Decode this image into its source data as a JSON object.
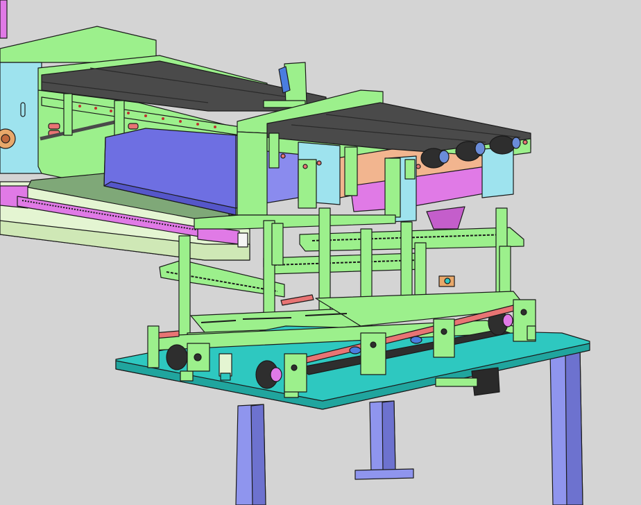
{
  "scene": {
    "kind": "cad-3d-model-render",
    "background": "#d4d4d4",
    "colors": {
      "frame_green": "#9cf08c",
      "frame_green_dark": "#5fb558",
      "edge": "#1a1a1a",
      "belt": "#4a4a4a",
      "roller": "#2e2e2e",
      "cyan_panel": "#9ee3ee",
      "blue_bin": "#6e6fe2",
      "magenta": "#e07ae6",
      "peach": "#f2b58f",
      "teal_base": "#2ec8c0",
      "leg_blue": "#8f95ee",
      "rod_red": "#e87474",
      "light_bed": "#e4f5d2",
      "motor": "#2a2a2a",
      "accent_orange": "#e8a86a"
    },
    "components": [
      {
        "name": "upper-conveyor",
        "icon": "belt-conveyor"
      },
      {
        "name": "lower-conveyor",
        "icon": "belt-conveyor"
      },
      {
        "name": "blue-hopper",
        "icon": "bin"
      },
      {
        "name": "magenta-chute",
        "icon": "chute"
      },
      {
        "name": "linear-rail-bed",
        "icon": "rail"
      },
      {
        "name": "adjustable-guide-frame",
        "icon": "frame"
      },
      {
        "name": "drive-base-plate",
        "icon": "plate"
      },
      {
        "name": "support-legs",
        "icon": "legs"
      },
      {
        "name": "drive-motor",
        "icon": "motor"
      }
    ]
  }
}
